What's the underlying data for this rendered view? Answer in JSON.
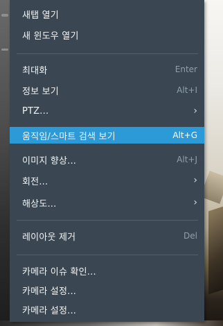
{
  "menu": {
    "items": [
      {
        "label": "새탭 열기",
        "shortcut": "",
        "submenu": false
      },
      {
        "label": "새 윈도우 열기",
        "shortcut": "",
        "submenu": false
      },
      {
        "label": "최대화",
        "shortcut": "Enter",
        "submenu": false
      },
      {
        "label": "정보 보기",
        "shortcut": "Alt+I",
        "submenu": false
      },
      {
        "label": "PTZ...",
        "shortcut": "",
        "submenu": true
      },
      {
        "label": "움직임/스마트 검색 보기",
        "shortcut": "Alt+G",
        "submenu": false,
        "highlighted": true
      },
      {
        "label": "이미지 향상...",
        "shortcut": "Alt+J",
        "submenu": false
      },
      {
        "label": "회전...",
        "shortcut": "",
        "submenu": true
      },
      {
        "label": "해상도...",
        "shortcut": "",
        "submenu": true
      },
      {
        "label": "레이아웃 제거",
        "shortcut": "Del",
        "submenu": false
      },
      {
        "label": "카메라 이슈 확인...",
        "shortcut": "",
        "submenu": false
      },
      {
        "label": "카메라 설정...",
        "shortcut": "",
        "submenu": false
      },
      {
        "label": "카메라 설정...",
        "shortcut": "",
        "submenu": false
      }
    ],
    "chevron_glyph": "›",
    "colors": {
      "background": "#3a4752",
      "highlight": "#2d9ad8",
      "text": "#f1f4f6",
      "shortcut": "#8fa0ab",
      "separator": "#52606b"
    }
  }
}
